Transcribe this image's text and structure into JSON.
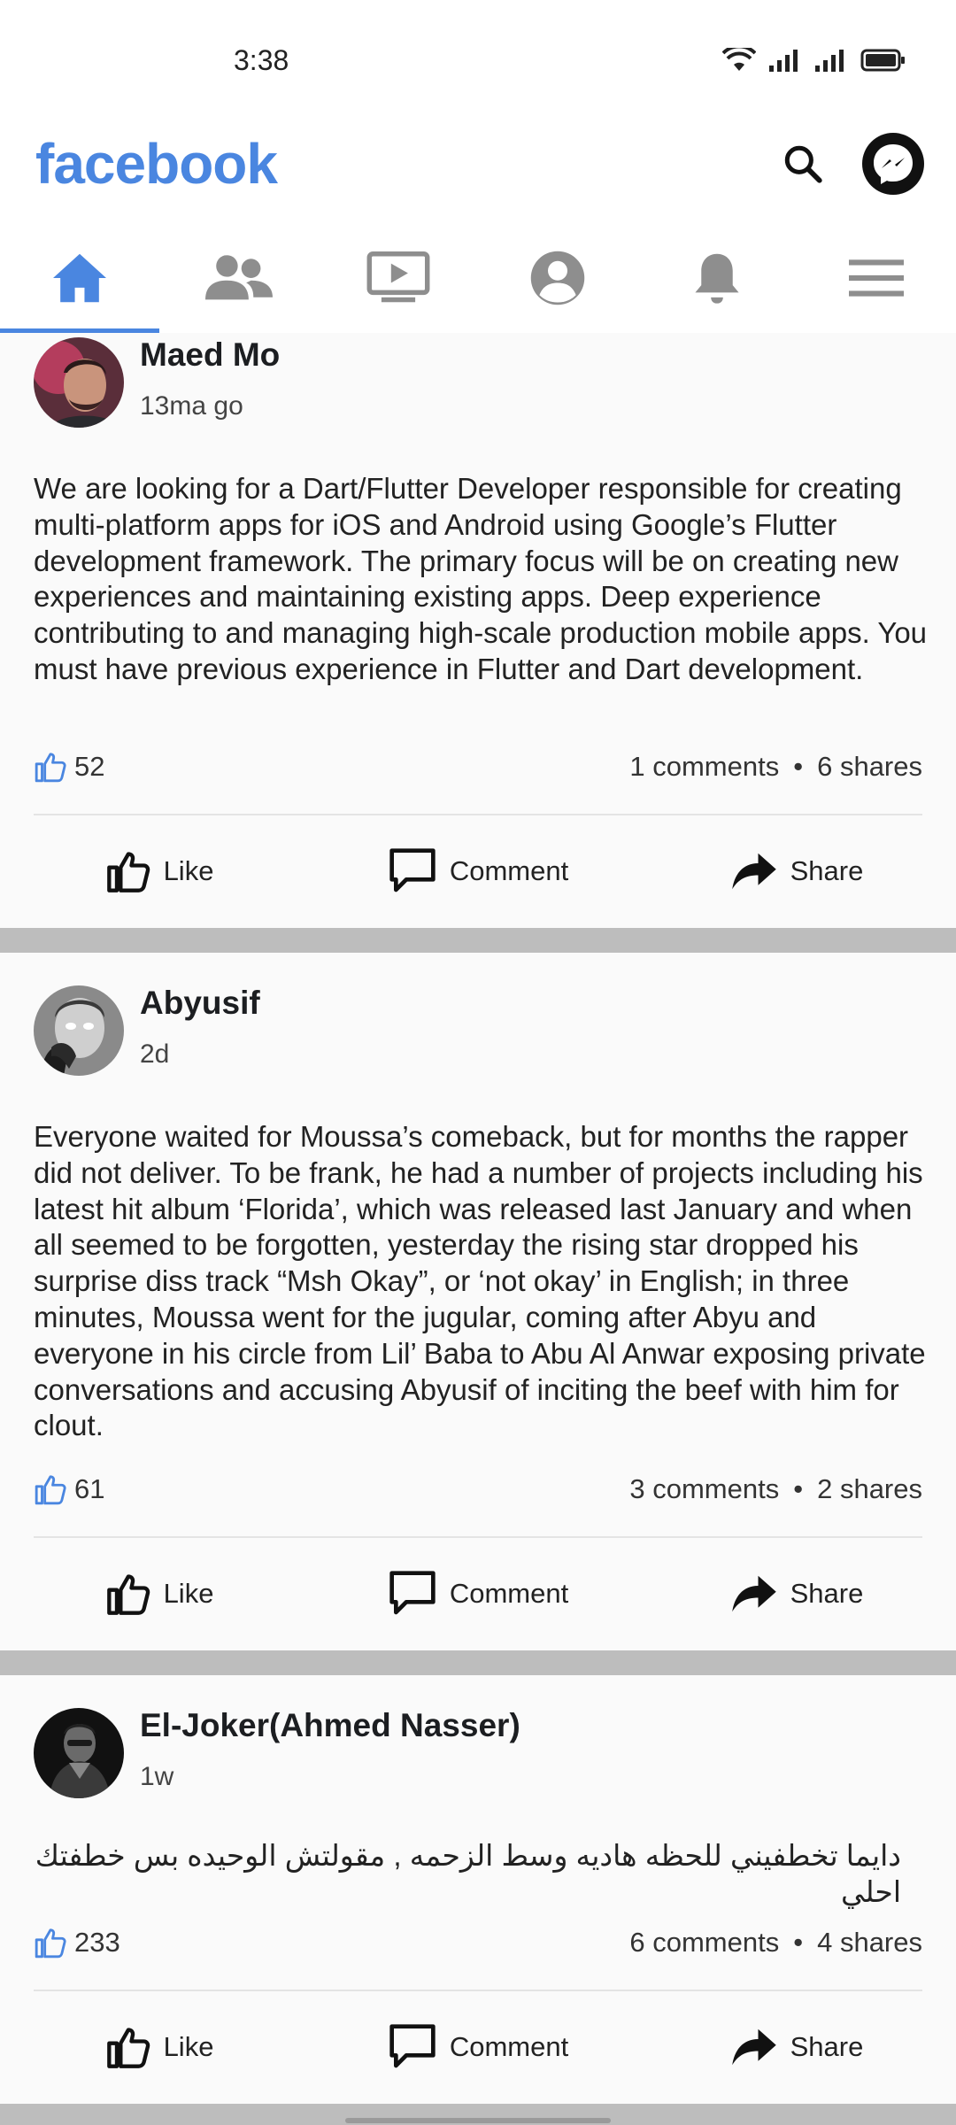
{
  "status_bar": {
    "time": "3:38"
  },
  "header": {
    "logo": "facebook"
  },
  "tabs": [
    {
      "name": "home",
      "icon": "home-icon",
      "active": true
    },
    {
      "name": "friends",
      "icon": "friends-icon"
    },
    {
      "name": "watch",
      "icon": "video-icon"
    },
    {
      "name": "profile",
      "icon": "profile-icon"
    },
    {
      "name": "notifications",
      "icon": "bell-icon"
    },
    {
      "name": "menu",
      "icon": "menu-icon"
    }
  ],
  "actions": {
    "like": "Like",
    "comment": "Comment",
    "share": "Share"
  },
  "posts": [
    {
      "author": "Maed Mo",
      "time": "13ma go",
      "text": "We are looking for a Dart/Flutter Developer responsible for creating multi-platform apps for iOS and Android using Google’s Flutter development framework. The primary focus will be on creating new experiences and maintaining existing apps. Deep experience contributing to and managing high-scale production mobile apps. You must have previous experience in Flutter and Dart development.",
      "likes": "52",
      "comments": "1 comments",
      "shares": "6 shares"
    },
    {
      "author": "Abyusif",
      "time": "2d",
      "text": "Everyone waited for Moussa’s comeback, but for months the rapper did not deliver. To be frank, he had a number of projects including his latest hit album ‘Florida’, which was released last January and when all seemed to be forgotten, yesterday the rising star dropped his surprise diss track “Msh Okay”, or ‘not okay’ in English; in three minutes, Moussa went for the jugular, coming after Abyu and everyone in his circle from Lil’ Baba to Abu Al Anwar exposing private conversations and accusing Abyusif of inciting the beef with him for clout.",
      "likes": "61",
      "comments": "3 comments",
      "shares": "2 shares"
    },
    {
      "author": "El-Joker(Ahmed Nasser)",
      "time": "1w",
      "text": "دايما تخطفيني للحظه هاديه  وسط الزحمه , مقولتش الوحيده بس خطفتك احلي",
      "likes": "233",
      "comments": "6 comments",
      "shares": "4 shares"
    }
  ],
  "separator": "•",
  "colors": {
    "brand": "#4a86e0",
    "feed_bg": "#bdbdbd",
    "card_bg": "#fafafa"
  }
}
